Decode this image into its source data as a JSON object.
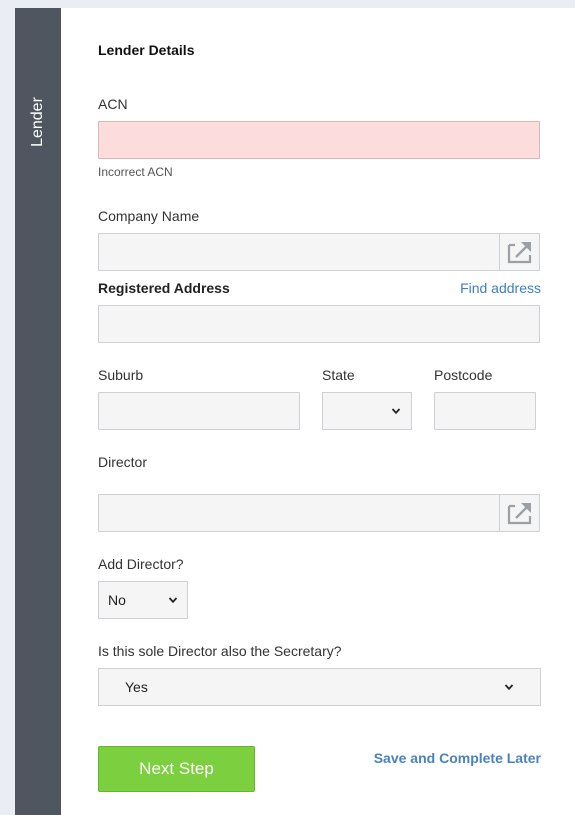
{
  "side_tab": {
    "label": "Lender"
  },
  "form": {
    "section_title": "Lender Details",
    "acn": {
      "label": "ACN",
      "value": "",
      "error": "Incorrect ACN"
    },
    "company_name": {
      "label": "Company Name",
      "value": ""
    },
    "registered_address": {
      "label": "Registered Address",
      "find_link": "Find address",
      "value": ""
    },
    "suburb": {
      "label": "Suburb",
      "value": ""
    },
    "state": {
      "label": "State",
      "value": ""
    },
    "postcode": {
      "label": "Postcode",
      "value": ""
    },
    "director": {
      "label": "Director",
      "value": ""
    },
    "add_director": {
      "label": "Add Director?",
      "value": "No"
    },
    "sole_director_secretary": {
      "label": "Is this sole Director also the Secretary?",
      "value": "Yes"
    }
  },
  "actions": {
    "next_step": "Next Step",
    "save_later": "Save and Complete Later"
  },
  "icons": {
    "popout": "popout-icon",
    "chevron": "chevron-down-icon"
  },
  "colors": {
    "side_tab": "#4f565f",
    "error_field": "#fcdcdc",
    "link": "#3d7fc1",
    "primary_button": "#7ccf3e"
  }
}
